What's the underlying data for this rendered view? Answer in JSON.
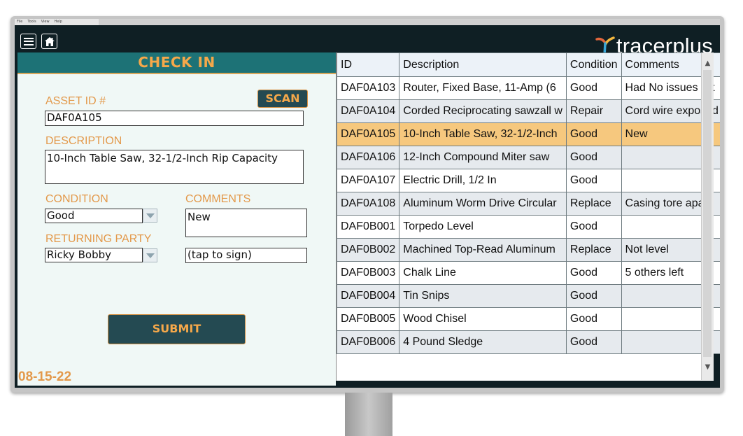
{
  "menubar": {
    "items": [
      "File",
      "Tools",
      "View",
      "Help"
    ]
  },
  "header": {
    "logo_text": "tracerplus",
    "accent": "#f5a84a"
  },
  "icons": {
    "menu": "hamburger-icon",
    "home": "home-icon",
    "logo": "tracerplus-logo-mark"
  },
  "form": {
    "title": "CHECK IN",
    "scan_label": "SCAN",
    "asset_id_label": "ASSET ID #",
    "asset_id_value": "DAF0A105",
    "description_label": "DESCRIPTION",
    "description_value": "10-Inch Table Saw, 32-1/2-Inch Rip Capacity",
    "condition_label": "CONDITION",
    "condition_value": "Good",
    "comments_label": "COMMENTS",
    "comments_value": "New",
    "returning_party_label": "RETURNING PARTY",
    "returning_party_value": "Ricky Bobby",
    "signature_placeholder": "(tap to sign)",
    "submit_label": "SUBMIT",
    "date": "08-15-22"
  },
  "table": {
    "columns": [
      "ID",
      "Description",
      "Condition",
      "Comments"
    ],
    "selected_index": 2,
    "rows": [
      {
        "id": "DAF0A103",
        "description": "Router, Fixed Base, 11-Amp (6",
        "condition": "Good",
        "comments": "Had No issues wit"
      },
      {
        "id": "DAF0A104",
        "description": "Corded Reciprocating sawzall w",
        "condition": "Repair",
        "comments": "Cord wire exposed"
      },
      {
        "id": "DAF0A105",
        "description": "10-Inch Table Saw, 32-1/2-Inch",
        "condition": "Good",
        "comments": "New"
      },
      {
        "id": "DAF0A106",
        "description": "12-Inch Compound Miter saw",
        "condition": "Good",
        "comments": ""
      },
      {
        "id": "DAF0A107",
        "description": "Electric Drill, 1/2 In",
        "condition": "Good",
        "comments": ""
      },
      {
        "id": "DAF0A108",
        "description": "Aluminum Worm Drive Circular",
        "condition": "Replace",
        "comments": "Casing tore apart"
      },
      {
        "id": "DAF0B001",
        "description": "Torpedo Level",
        "condition": "Good",
        "comments": ""
      },
      {
        "id": "DAF0B002",
        "description": "Machined Top-Read Aluminum",
        "condition": "Replace",
        "comments": "Not level"
      },
      {
        "id": "DAF0B003",
        "description": "Chalk Line",
        "condition": "Good",
        "comments": "5 others left"
      },
      {
        "id": "DAF0B004",
        "description": "Tin Snips",
        "condition": "Good",
        "comments": ""
      },
      {
        "id": "DAF0B005",
        "description": "Wood Chisel",
        "condition": "Good",
        "comments": ""
      },
      {
        "id": "DAF0B006",
        "description": "4 Pound Sledge",
        "condition": "Good",
        "comments": ""
      }
    ]
  }
}
